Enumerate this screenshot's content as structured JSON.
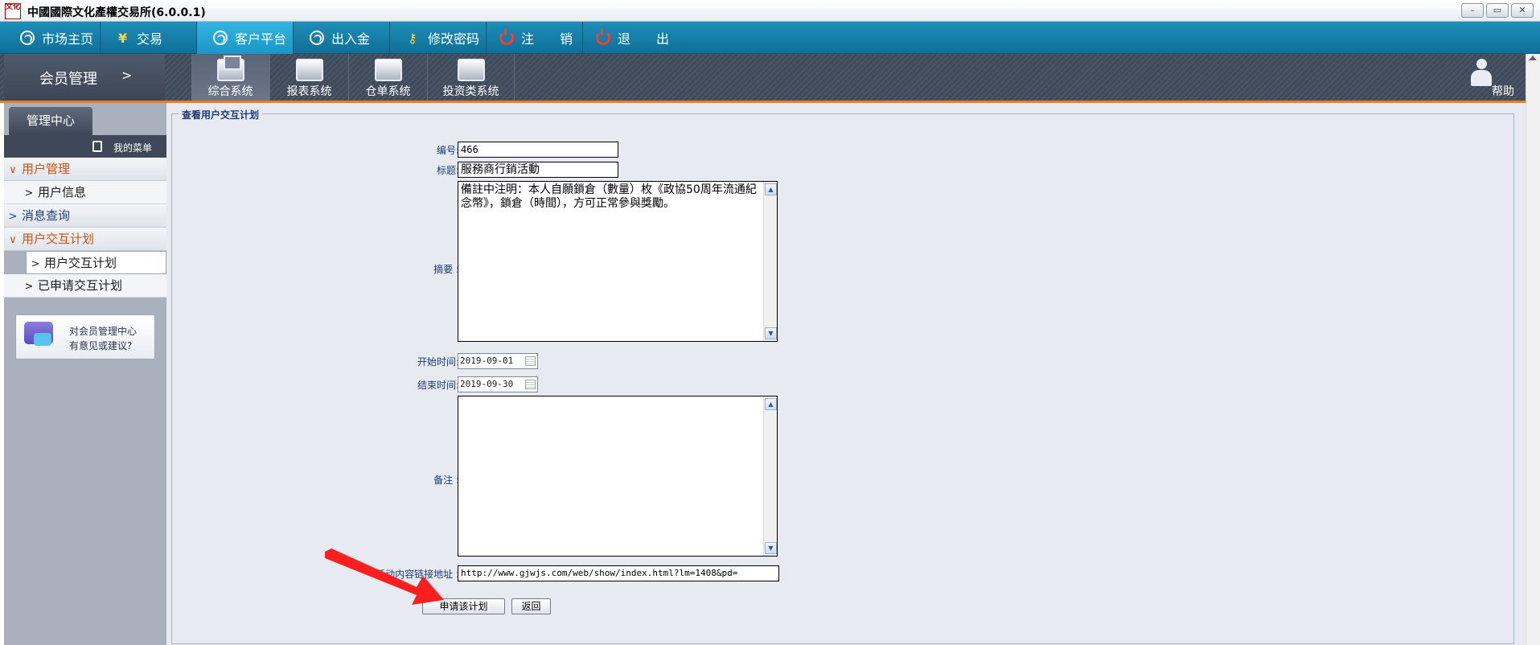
{
  "window": {
    "title": "中國國際文化產權交易所(6.0.0.1)",
    "logo_text": "文化",
    "buttons": {
      "minimize": "–",
      "restore": "▭",
      "close": "✕"
    }
  },
  "topnav": {
    "items": [
      {
        "label": "市场主页",
        "icon": "swirl-icon"
      },
      {
        "label": "交易",
        "icon": "yen-icon"
      },
      {
        "label": "客户平台",
        "icon": "swirl-icon",
        "active": true
      },
      {
        "label": "出入金",
        "icon": "swirl-icon"
      },
      {
        "label": "修改密码",
        "icon": "key-icon"
      },
      {
        "label": "注　　销",
        "icon": "power-icon"
      },
      {
        "label": "退　　出",
        "icon": "power-icon"
      }
    ]
  },
  "subheader": {
    "member_title": "会员管理",
    "member_arrow": ">",
    "systems": [
      {
        "label": "综合系统",
        "active": true
      },
      {
        "label": "报表系统"
      },
      {
        "label": "仓单系统"
      },
      {
        "label": "投资类系统"
      }
    ],
    "help": "帮助"
  },
  "sidebar": {
    "tab": "管理中心",
    "my_menu": "我的菜单",
    "rows": [
      {
        "label": "用户管理",
        "kind": "group",
        "open": true
      },
      {
        "label": "用户信息",
        "kind": "item"
      },
      {
        "label": "消息查询",
        "kind": "group",
        "open": false
      },
      {
        "label": "用户交互计划",
        "kind": "group",
        "open": true
      },
      {
        "label": "用户交互计划",
        "kind": "item",
        "selected": true
      },
      {
        "label": "已申请交互计划",
        "kind": "item"
      }
    ],
    "suggest": {
      "line1": "对会员管理中心",
      "line2": "有意见或建议?"
    }
  },
  "form": {
    "legend": "查看用户交互计划",
    "fields": {
      "id_label": "编号:",
      "id_value": "466",
      "title_label": "标题:",
      "title_value": "服務商行銷活動",
      "summary_label": "摘要 :",
      "summary_value": "備註中注明：本人自願鎖倉（數量）枚《政協50周年流通紀念幣》，鎖倉（時間），方可正常參與獎勵。",
      "start_label": "开始时间:",
      "start_value": "2019-09-01",
      "end_label": "结束时间:",
      "end_value": "2019-09-30",
      "remark_label": "备注 :",
      "remark_value": "",
      "link_label": "活动内容链接地址 :",
      "link_value": "http://www.gjwjs.com/web/show/index.html?lm=1408&pd="
    },
    "buttons": {
      "apply": "申请该计划",
      "back": "返回"
    }
  },
  "colors": {
    "nav_bg": "#1487b2",
    "accent_orange": "#f07a1f",
    "annotation_red": "#ff1f1f"
  }
}
